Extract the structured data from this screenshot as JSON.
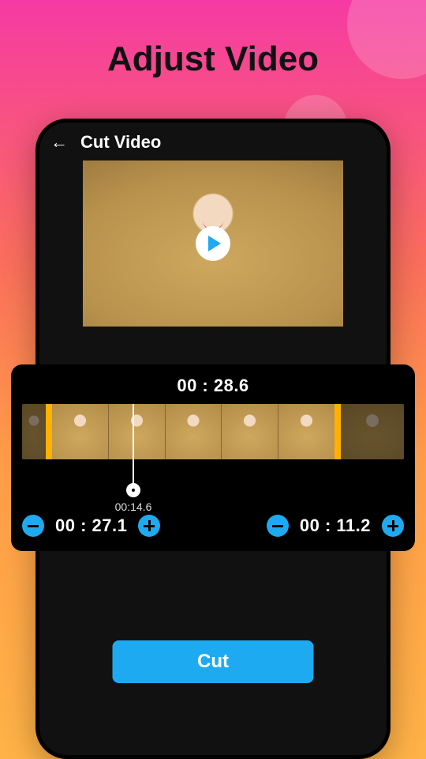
{
  "promo": {
    "title": "Adjust Video"
  },
  "header": {
    "screen_title": "Cut Video"
  },
  "timeline": {
    "total_duration": "00 : 28.6",
    "playhead_time": "00:14.6",
    "start_time": "00 : 27.1",
    "end_time": "00 : 11.2"
  },
  "actions": {
    "cut_label": "Cut"
  },
  "colors": {
    "accent": "#1eaaf1",
    "handle": "#ffb100"
  }
}
